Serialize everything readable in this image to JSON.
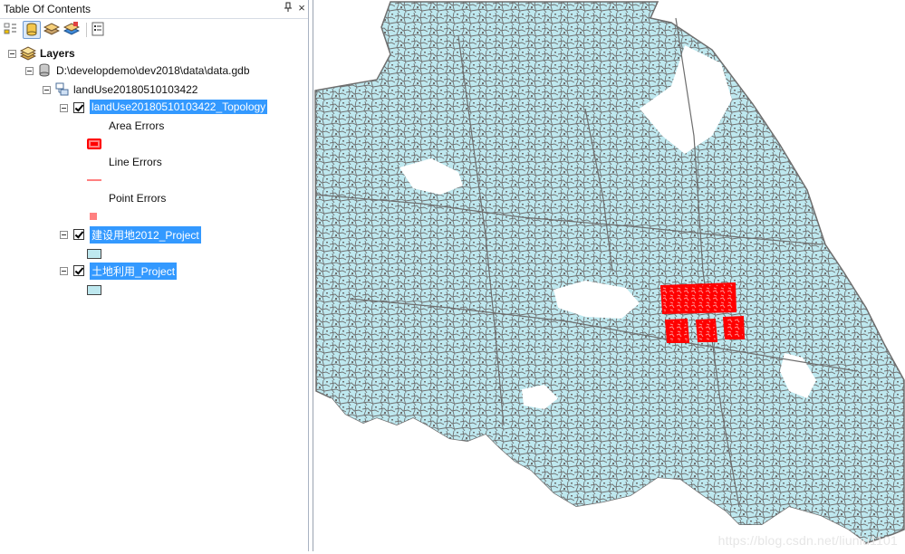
{
  "panel": {
    "title": "Table Of Contents",
    "pin_glyph": "↕",
    "close_glyph": "×"
  },
  "toolbar": {
    "tools": [
      {
        "name": "list-by-drawing-order"
      },
      {
        "name": "list-by-source"
      },
      {
        "name": "list-by-visibility"
      },
      {
        "name": "list-by-selection"
      },
      {
        "name": "options"
      }
    ]
  },
  "tree": {
    "root_label": "Layers",
    "gdb_label": "D:\\developdemo\\dev2018\\data\\data.gdb",
    "dataset_label": "landUse20180510103422",
    "topology": {
      "label": "landUse20180510103422_Topology",
      "checked": true,
      "legend": [
        {
          "label": "Area Errors",
          "color": "#ff0000"
        },
        {
          "label": "Line Errors",
          "color": "#ff8080"
        },
        {
          "label": "Point Errors",
          "color": "#ff8080"
        }
      ]
    },
    "layer1": {
      "label": "建设用地2012_Project",
      "checked": true,
      "fill": "#bee8ef"
    },
    "layer2": {
      "label": "土地利用_Project",
      "checked": true,
      "fill": "#bee8ef"
    }
  },
  "map": {
    "fill_color": "#bee8ef",
    "outline_color": "#6e6e6e",
    "error_color": "#ff0000",
    "watermark": "https://blog.csdn.net/liuniu1101"
  }
}
